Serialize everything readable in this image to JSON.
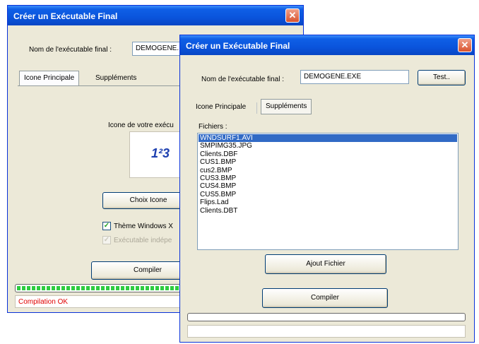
{
  "colors": {
    "titlebar": "#0a54dc",
    "window_bg": "#ece9d8",
    "selection": "#316ac5",
    "progress_fill": "#2ecc40",
    "status_error_text": "#e00000"
  },
  "back_window": {
    "title": "Créer un Exécutable Final",
    "close_icon": "close-icon",
    "name_label": "Nom de l'exécutable final :",
    "name_value": "DEMOGENE.",
    "tabs": [
      {
        "label": "Icone Principale",
        "active": true
      },
      {
        "label": "Suppléments",
        "active": false
      }
    ],
    "icon_caption": "Icone de votre exécu",
    "icon_glyph": "1²3",
    "choose_icon_button": "Choix Icone",
    "checkbox_theme": {
      "label": "Thème Windows X",
      "checked": true
    },
    "checkbox_independent": {
      "label": "Exécutable indépe",
      "checked": true,
      "disabled": true
    },
    "compile_button": "Compiler",
    "progress_fraction": 1.0,
    "status_text": "Compilation OK"
  },
  "front_window": {
    "title": "Créer un Exécutable Final",
    "close_icon": "close-icon",
    "name_label": "Nom de l'exécutable final :",
    "name_value": "DEMOGENE.EXE",
    "test_button": "Test..",
    "tabs": [
      {
        "label": "Icone Principale",
        "active": false
      },
      {
        "label": "Suppléments",
        "active": true
      }
    ],
    "files_label": "Fichiers :",
    "files": [
      {
        "name": "WNDSURF1.AVI",
        "selected": true
      },
      {
        "name": "SMPIMG35.JPG",
        "selected": false
      },
      {
        "name": "Clients.DBF",
        "selected": false
      },
      {
        "name": "CUS1.BMP",
        "selected": false
      },
      {
        "name": "cus2.BMP",
        "selected": false
      },
      {
        "name": "CUS3.BMP",
        "selected": false
      },
      {
        "name": "CUS4.BMP",
        "selected": false
      },
      {
        "name": "CUS5.BMP",
        "selected": false
      },
      {
        "name": "Flips.Lad",
        "selected": false
      },
      {
        "name": "Clients.DBT",
        "selected": false
      }
    ],
    "add_file_button": "Ajout Fichier",
    "compile_button": "Compiler",
    "progress_fraction": 0,
    "status_text": ""
  }
}
